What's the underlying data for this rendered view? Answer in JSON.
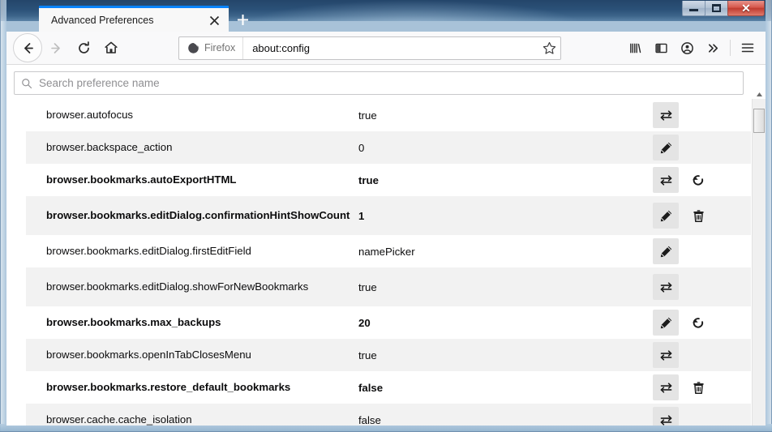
{
  "window": {
    "controls": {
      "minimize": "Minimize",
      "maximize": "Restore",
      "close": "✕"
    }
  },
  "tabs": {
    "active_tab_title": "Advanced Preferences",
    "close_tab_label": "Close tab",
    "new_tab_label": "New tab"
  },
  "toolbar": {
    "back_label": "Back",
    "forward_label": "Forward",
    "reload_label": "Reload",
    "home_label": "Home",
    "identity_label": "Firefox",
    "url": "about:config",
    "bookmark_label": "Bookmark this page",
    "library_label": "Library",
    "sidebar_label": "Sidebar",
    "account_label": "Account",
    "overflow_label": "More tools",
    "menu_label": "Open application menu"
  },
  "search": {
    "placeholder": "Search preference name",
    "value": "",
    "icon": "search-icon"
  },
  "preferences": [
    {
      "name": "browser.autofocus",
      "value": "true",
      "modified": false,
      "actions": [
        "toggle"
      ]
    },
    {
      "name": "browser.backspace_action",
      "value": "0",
      "modified": false,
      "actions": [
        "edit"
      ]
    },
    {
      "name": "browser.bookmarks.autoExportHTML",
      "value": "true",
      "modified": true,
      "actions": [
        "toggle",
        "reset"
      ]
    },
    {
      "name": "browser.bookmarks.editDialog.confirmationHintShowCount",
      "value": "1",
      "modified": true,
      "actions": [
        "edit",
        "delete"
      ]
    },
    {
      "name": "browser.bookmarks.editDialog.firstEditField",
      "value": "namePicker",
      "modified": false,
      "actions": [
        "edit"
      ]
    },
    {
      "name": "browser.bookmarks.editDialog.showForNewBookmarks",
      "value": "true",
      "modified": false,
      "actions": [
        "toggle"
      ]
    },
    {
      "name": "browser.bookmarks.max_backups",
      "value": "20",
      "modified": true,
      "actions": [
        "edit",
        "reset"
      ]
    },
    {
      "name": "browser.bookmarks.openInTabClosesMenu",
      "value": "true",
      "modified": false,
      "actions": [
        "toggle"
      ]
    },
    {
      "name": "browser.bookmarks.restore_default_bookmarks",
      "value": "false",
      "modified": true,
      "actions": [
        "toggle",
        "delete"
      ]
    },
    {
      "name": "browser.cache.cache_isolation",
      "value": "false",
      "modified": false,
      "actions": [
        "toggle"
      ]
    }
  ],
  "action_labels": {
    "toggle": "Toggle",
    "edit": "Edit",
    "reset": "Reset",
    "delete": "Delete"
  },
  "colors": {
    "accent": "#0a84ff",
    "row_alt": "#f2f2f2",
    "chrome": "#f9f9fa",
    "close_button": "#c03c30"
  }
}
